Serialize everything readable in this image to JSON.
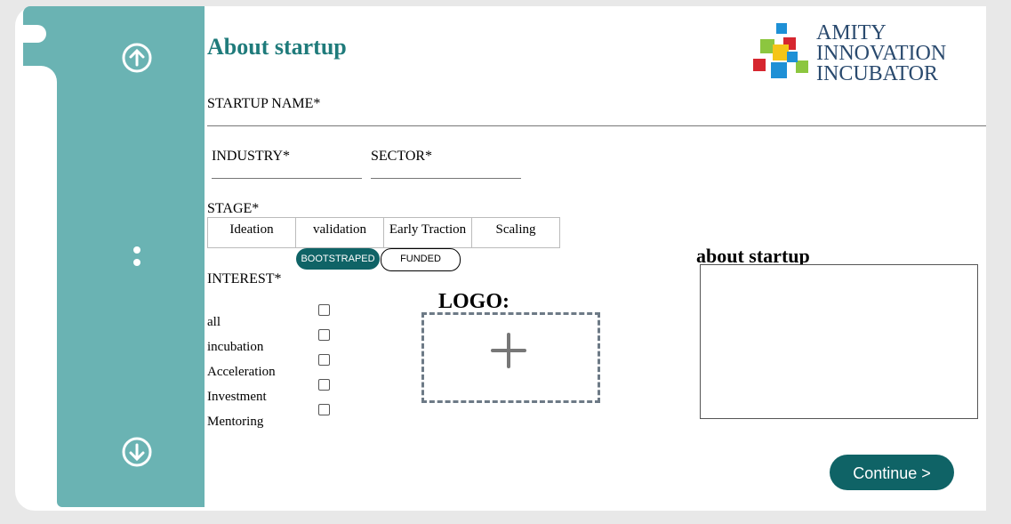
{
  "page": {
    "title": "About startup"
  },
  "brand": {
    "line1": "AMITY",
    "line2": "INNOVATION",
    "line3": "INCUBATOR"
  },
  "fields": {
    "startup_name_label": "STARTUP NAME*",
    "industry_label": "INDUSTRY*",
    "sector_label": "SECTOR*",
    "stage_label": "STAGE*",
    "interest_label": "INTEREST*"
  },
  "stages": [
    "Ideation",
    "validation",
    "Early Traction",
    "Scaling"
  ],
  "funding": {
    "selected": "BOOTSTRAPED",
    "other": "FUNDED"
  },
  "interests": [
    "all",
    "incubation",
    "Acceleration",
    "Investment",
    "Mentoring"
  ],
  "logo_label": "LOGO:",
  "about_label": "about startup",
  "continue_label": "Continue  >",
  "colors": {
    "sidebar": "#6ab3b3",
    "accent": "#0f6366",
    "title": "#1f7b7b"
  },
  "icons": {
    "scroll_up": "arrow-up-circle",
    "scroll_down": "arrow-down-circle",
    "more": "vertical-dots",
    "add": "plus"
  }
}
